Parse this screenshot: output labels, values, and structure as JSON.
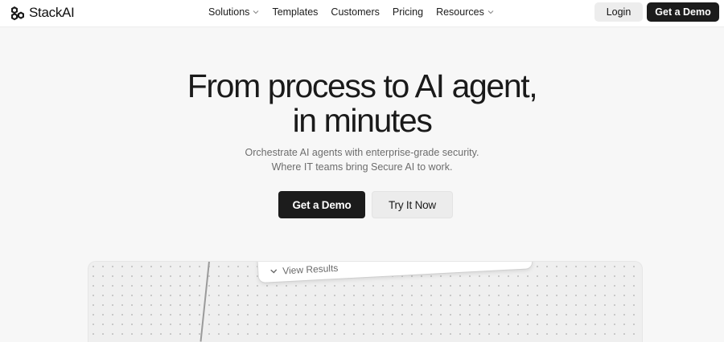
{
  "brand": {
    "name": "StackAI"
  },
  "nav": {
    "links": [
      {
        "label": "Solutions",
        "dropdown": true
      },
      {
        "label": "Templates",
        "dropdown": false
      },
      {
        "label": "Customers",
        "dropdown": false
      },
      {
        "label": "Pricing",
        "dropdown": false
      },
      {
        "label": "Resources",
        "dropdown": true
      }
    ],
    "login_label": "Login",
    "demo_label": "Get a Demo"
  },
  "hero": {
    "title_line1": "From process to AI agent,",
    "title_line2": "in minutes",
    "subtitle_line1": "Orchestrate AI agents with enterprise-grade security.",
    "subtitle_line2": "Where IT teams bring Secure AI to work.",
    "primary_cta": "Get a Demo",
    "secondary_cta": "Try It Now"
  },
  "preview": {
    "toggle_label": "View Results",
    "toggle_icon": "chevron-down-icon"
  },
  "colors": {
    "dark": "#1c1c1c",
    "page_bg": "#f7f7f7",
    "muted_text": "#6d6d6d"
  }
}
